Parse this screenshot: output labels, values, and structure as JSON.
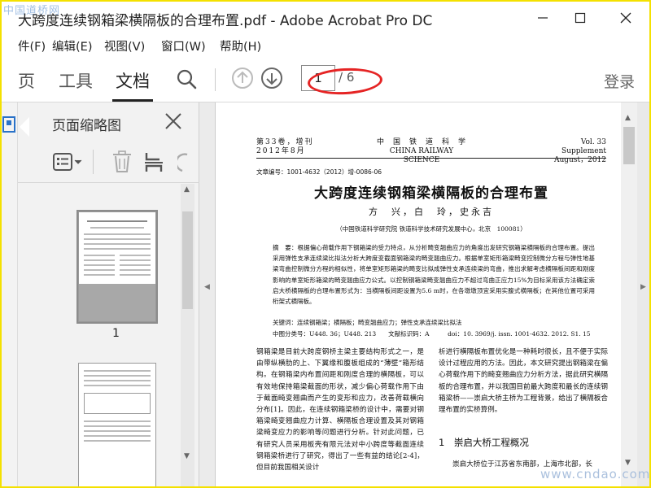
{
  "window": {
    "title": "大跨度连续钢箱梁横隔板的合理布置.pdf - Adobe Acrobat Pro DC",
    "minimize_glyph": "—",
    "maximize_glyph": "☐",
    "close_glyph": "✕"
  },
  "watermark": {
    "top_left": "中国道桥网",
    "bottom_right": "www.cndao.com"
  },
  "menu": {
    "items": [
      "件(F)",
      "编辑(E)",
      "视图(V)",
      "窗口(W)",
      "帮助(H)"
    ]
  },
  "toolbar": {
    "tabs": [
      "页",
      "工具",
      "文档"
    ],
    "active_tab": "文档",
    "page_current": "1",
    "page_total": "/ 6",
    "login_label": "登录",
    "icons": [
      "search-icon",
      "page-up-icon",
      "page-down-icon"
    ]
  },
  "thumbnail_panel": {
    "title": "页面缩略图",
    "page_labels": [
      "1"
    ],
    "tool_icons": [
      "thumbnail-options-icon",
      "delete-page-icon",
      "extract-page-icon",
      "rotate-page-icon"
    ]
  },
  "document": {
    "header_left": [
      "第33卷，增刊",
      "2012年8月"
    ],
    "header_center": [
      "中　国　铁　道　科　学",
      "CHINA RAILWAY SCIENCE"
    ],
    "header_right": [
      "Vol. 33　Supplement",
      "August，2012"
    ],
    "article_no": "文章编号：1001-4632（2012）增-0086-06",
    "title": "大跨度连续钢箱梁横隔板的合理布置",
    "authors": "方　兴，白　玲，史永吉",
    "affiliation": "（中国铁道科学研究院 铁道科学技术研究发展中心，北京　100081）",
    "abstract": "摘　要：根据偏心荷载作用下钢箱梁的受力特点，从分析畸变翘曲应力的角度出发研究钢箱梁横隔板的合理布置。提出采用弹性支承连续梁比拟法分析大跨度变截面钢箱梁的畸变翘曲应力。根据单室矩形箱梁畸变控制微分方程与弹性地基梁弯曲控制微分方程的相似性，将单室矩形箱梁的畸变比拟成弹性支承连续梁的弯曲，推出求解考虑横隔板间距和刚度影响的单室矩形箱梁的畸变翘曲应力公式。以控制钢箱梁畸变翘曲应力不超过弯曲正应力15%为目标采用该方法确定崇启大桥横隔板的合理布置形式为：当横隔板间距设置为5.6 m时，在各墩墩顶宜采用实腹式横隔板；在其他位置可采用桁架式横隔板。",
    "keywords": "关键词：连续钢箱梁；横隔板；畸变翘曲应力；弹性支承连续梁比拟法",
    "classification": "中图分类号：U448. 36；U448. 213　　文献标识码：A　　　doi：10. 3969/j. issn. 1001-4632. 2012. S1. 15",
    "col1": "钢箱梁是目前大跨度钢桥主梁主要结构形式之一，是由带纵横肋的上、下翼缘和腹板组成的“薄壁”箱形结构。在钢箱梁内布置间距和刚度合理的横隔板，可以有效地保持箱梁截面的形状，减少偏心荷载作用下由于截面畸变翘曲而产生的变形和应力，改善荷载横向分布[1]。因此，在连续钢箱梁桥的设计中，需要对钢箱梁畸变翘曲应力计算、横隔板合理设置及其对钢箱梁畸变应力的影响等问题进行分析。针对此问题，已有研究人员采用板壳有限元法对中小跨度等截面连续钢箱梁桥进行了研究，得出了一些有益的结论[2-4]，但目前我国相关设计",
    "col2": "析进行横隔板布置优化是一种耗时很长，且不便于实际设计过程应用的方法。因此，本文研究提出钢箱梁在偏心荷载作用下的畸变翘曲应力分析方法，据此研究横隔板的合理布置，并以我国目前最大跨度和最长的连续钢箱梁桥——崇启大桥主桥为工程背景，给出了横隔板合理布置的实桥算例。",
    "section_heading": "1　崇启大桥工程概况",
    "section_body": "崇启大桥位于江苏省东南部，上海市北部，长"
  }
}
